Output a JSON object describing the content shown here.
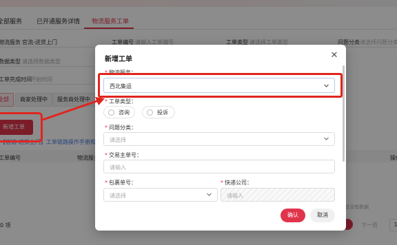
{
  "tabs": [
    {
      "label": "全部服务",
      "active": false
    },
    {
      "label": "已开通服务详情",
      "active": false
    },
    {
      "label": "物流服务工单",
      "active": true
    }
  ],
  "filters": {
    "service_label": "物流服务",
    "service_value": "官流-送货上门",
    "order_no_label": "工单编号",
    "order_no_placeholder": "请输入工单编号",
    "order_type_label": "工单类型",
    "order_type_placeholder": "请选择工单类型",
    "problem_label": "问题分类",
    "problem_placeholder": "请选择问题分类",
    "data_type_label": "数据类型",
    "data_type_placeholder": "请选择数据类型",
    "complete_time_label": "工单完成时间",
    "complete_time_placeholder": "开始时间"
  },
  "segments": [
    "全部",
    "商家处理中",
    "服务商处理中"
  ],
  "background": {
    "new_button": "新增工单",
    "link_text": "【官流-送货上门】工单链路操作手册和常",
    "col_order_no": "工单编号",
    "col_service": "物流服务",
    "col_ops": "操作",
    "no_data": "暂没有数据",
    "total": "0 项",
    "next_page": "下一页",
    "page_num": "1"
  },
  "modal": {
    "title": "新增工单",
    "close_icon": "close-icon",
    "service_label": "物流服务：",
    "service_value": "西北集运",
    "type_label": "工单类型：",
    "type_options": [
      "咨询",
      "投诉"
    ],
    "problem_label": "问题分类：",
    "problem_placeholder": "请选择",
    "tx_label": "交易主单号：",
    "tx_placeholder": "请输入",
    "parcel_label": "包裹单号：",
    "parcel_placeholder": "请选择",
    "express_label": "快递公司：",
    "express_placeholder": "请输入",
    "confirm": "确认",
    "cancel": "取消"
  },
  "colors": {
    "accent": "#e0344b",
    "annotation": "#e0251e"
  }
}
